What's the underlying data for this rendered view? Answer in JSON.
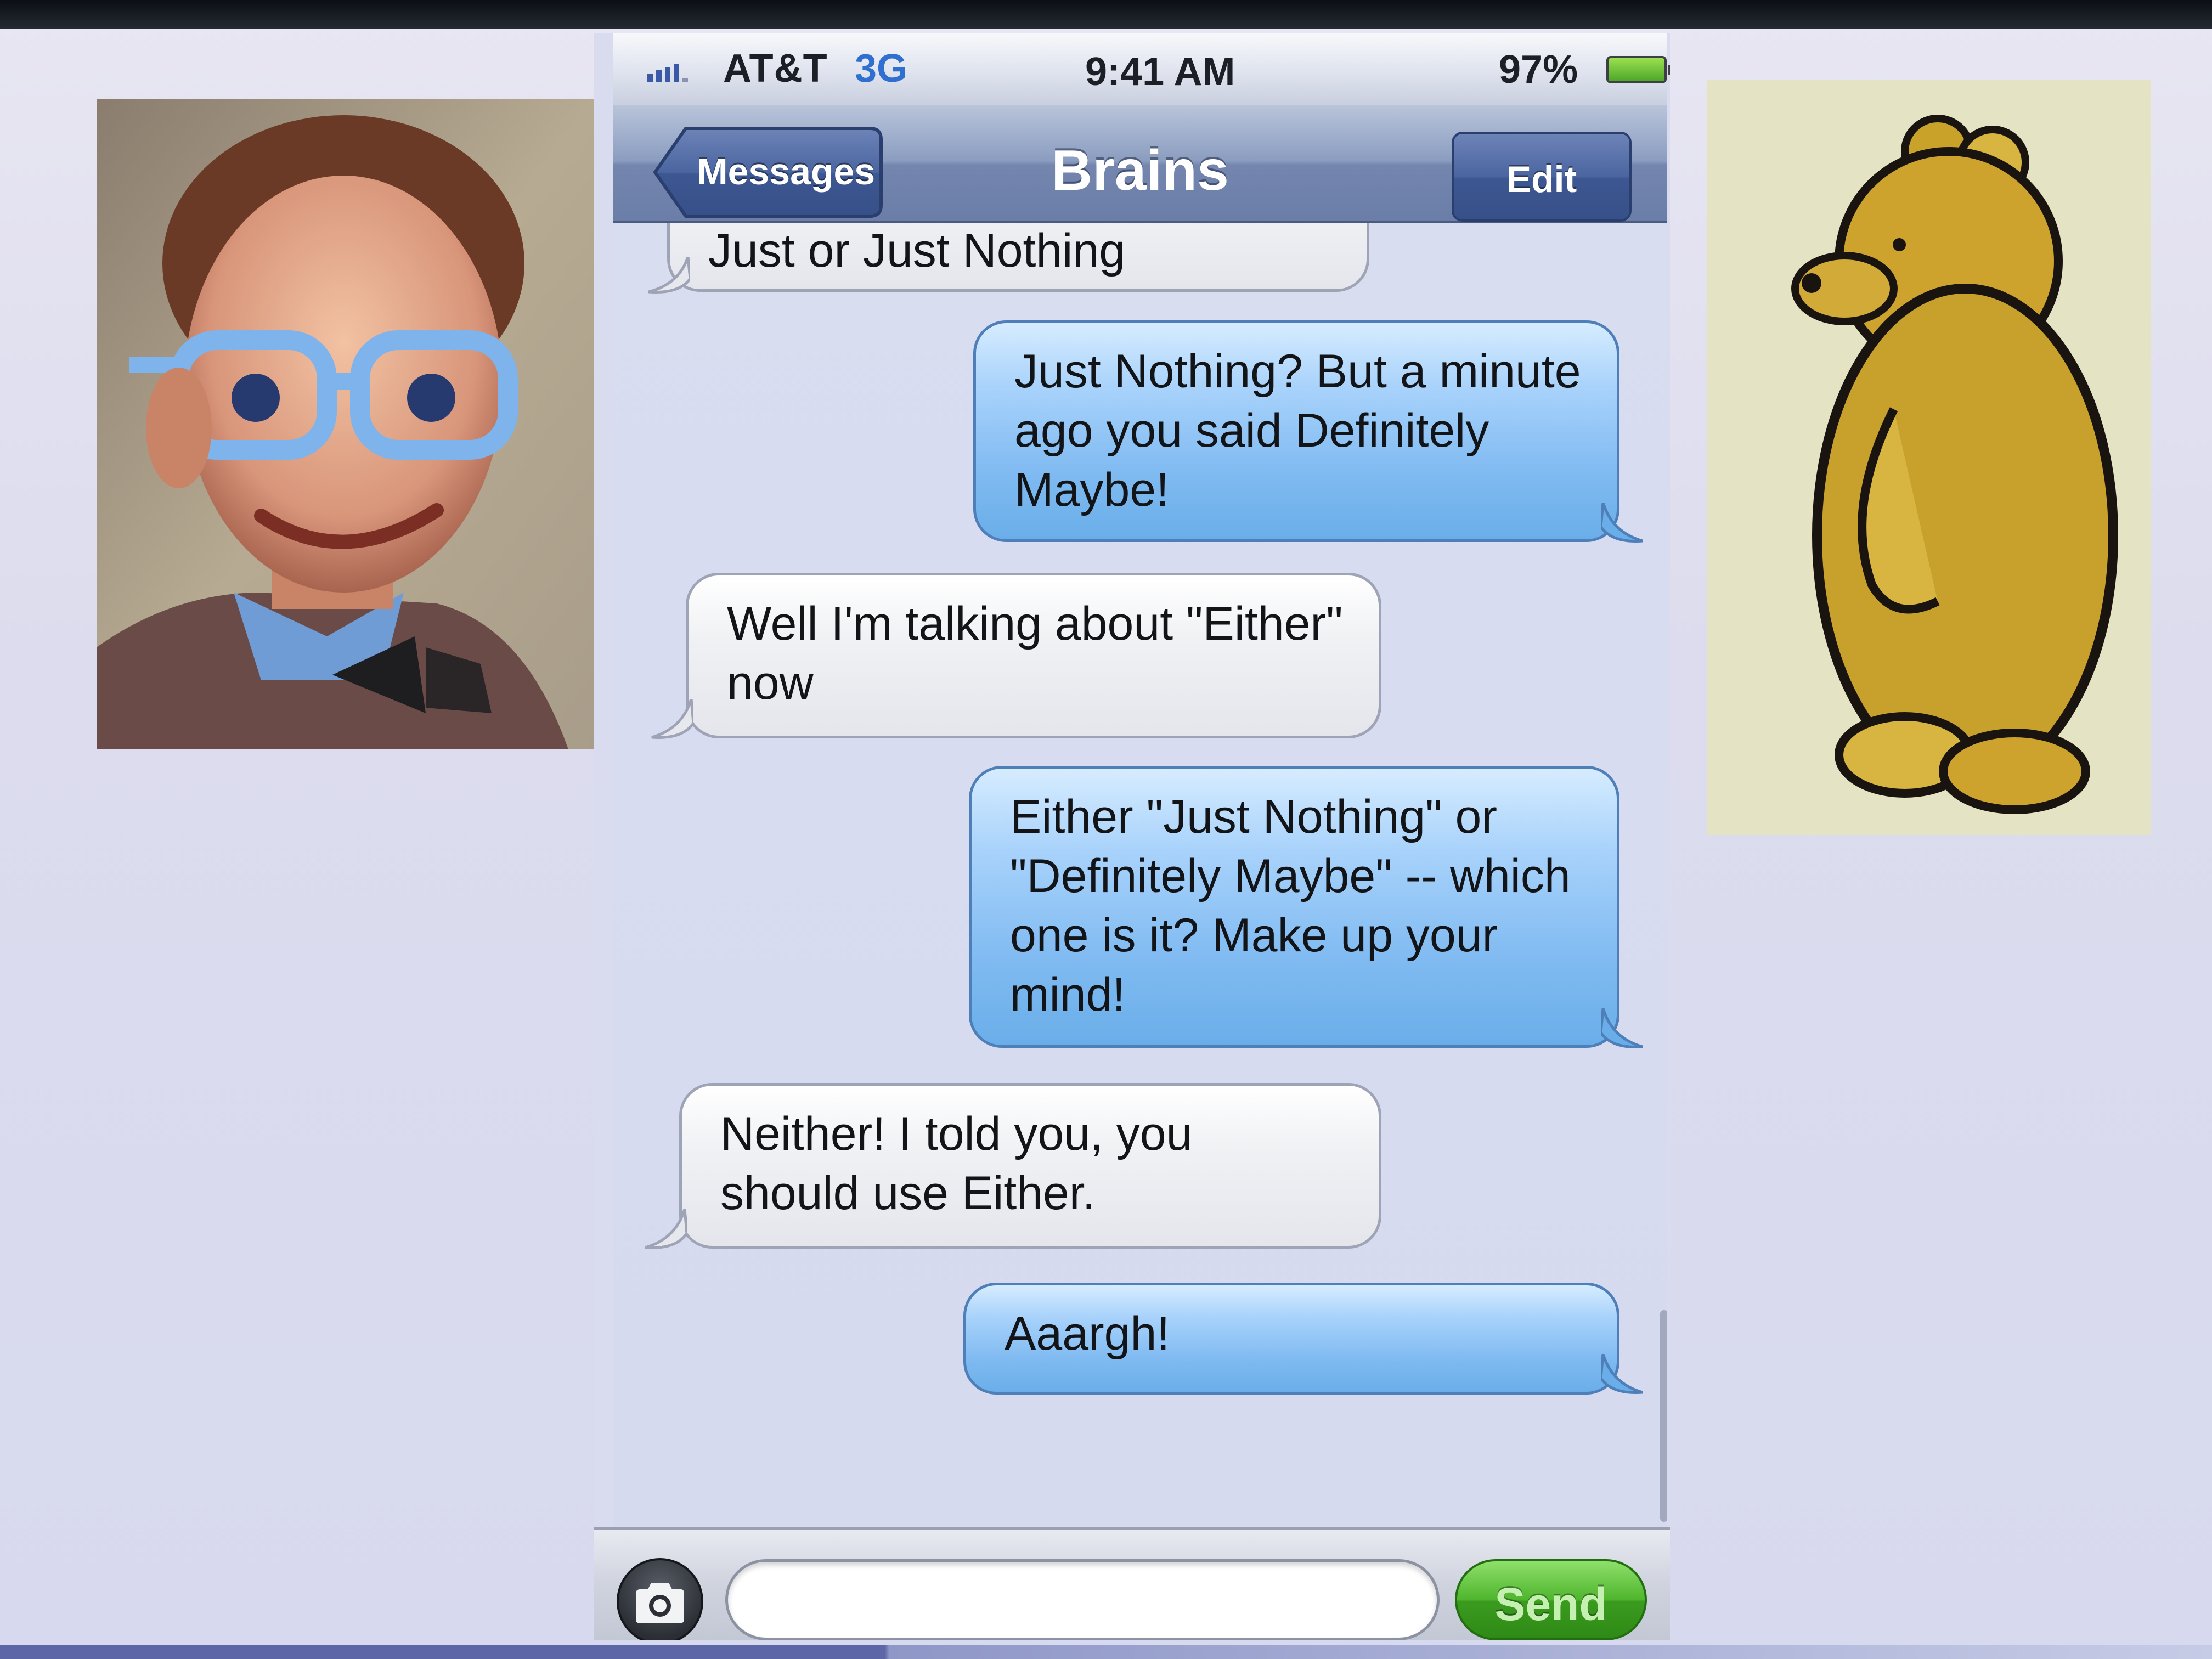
{
  "status_bar": {
    "carrier": "AT&T",
    "network": "3G",
    "time": "9:41 AM",
    "battery_percent": "97%"
  },
  "nav": {
    "back_label": "Messages",
    "title": "Brains",
    "edit_label": "Edit"
  },
  "messages": [
    {
      "direction": "incoming",
      "lines": [
        "Just or Just Nothing"
      ]
    },
    {
      "direction": "outgoing",
      "lines": [
        "Just Nothing? But a minute",
        "ago you said Definitely",
        "Maybe!"
      ]
    },
    {
      "direction": "incoming",
      "lines": [
        "Well I'm talking about \"Either\"",
        "now"
      ]
    },
    {
      "direction": "outgoing",
      "lines": [
        "Either \"Just Nothing\" or",
        "\"Definitely Maybe\" -- which",
        "one is it? Make up your",
        "mind!"
      ]
    },
    {
      "direction": "incoming",
      "lines": [
        "Neither! I told you, you",
        "should use Either."
      ]
    },
    {
      "direction": "outgoing",
      "lines": [
        "Aaargh!"
      ]
    }
  ],
  "input_bar": {
    "field_value": "",
    "send_label": "Send"
  },
  "colors": {
    "nav_blue": "#6a7ea8",
    "outgoing_bubble": "#7fbaf1",
    "incoming_bubble": "#f0f1f4",
    "send_green": "#4fb52e",
    "network_blue": "#2f6fd0"
  },
  "icons": {
    "camera": "camera-icon",
    "back": "back-arrow-button",
    "battery": "battery-icon",
    "signal": "signal-bars-icon"
  }
}
